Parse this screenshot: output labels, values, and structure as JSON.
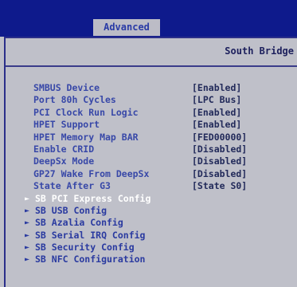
{
  "header": {
    "active_tab": "Advanced"
  },
  "section": {
    "title": "South Bridge"
  },
  "settings": [
    {
      "label": "SMBUS Device",
      "value": "[Enabled]"
    },
    {
      "label": "Port 80h Cycles",
      "value": "[LPC Bus]"
    },
    {
      "label": "PCI Clock Run Logic",
      "value": "[Enabled]"
    },
    {
      "label": "HPET Support",
      "value": "[Enabled]"
    },
    {
      "label": "HPET Memory Map BAR",
      "value": "[FED00000]"
    },
    {
      "label": "Enable CRID",
      "value": "[Disabled]"
    },
    {
      "label": "DeepSx Mode",
      "value": "[Disabled]"
    },
    {
      "label": "GP27 Wake From DeepSx",
      "value": "[Disabled]"
    },
    {
      "label": "State After G3",
      "value": "[State S0]"
    }
  ],
  "submenus": [
    {
      "label": "SB PCI Express Config",
      "arrow": "►",
      "selected": true
    },
    {
      "label": "SB USB Config",
      "arrow": "►",
      "selected": false
    },
    {
      "label": "SB Azalia Config",
      "arrow": "►",
      "selected": false
    },
    {
      "label": "SB Serial IRQ Config",
      "arrow": "►",
      "selected": false
    },
    {
      "label": "SB Security Config",
      "arrow": "►",
      "selected": false
    },
    {
      "label": "SB NFC Configuration",
      "arrow": "►",
      "selected": false
    }
  ],
  "colors": {
    "top_bar": "#0e1a8c",
    "background": "#bfc0c9",
    "label_text": "#3848a8",
    "value_text": "#222a5a",
    "selected_text": "#ffffff"
  }
}
